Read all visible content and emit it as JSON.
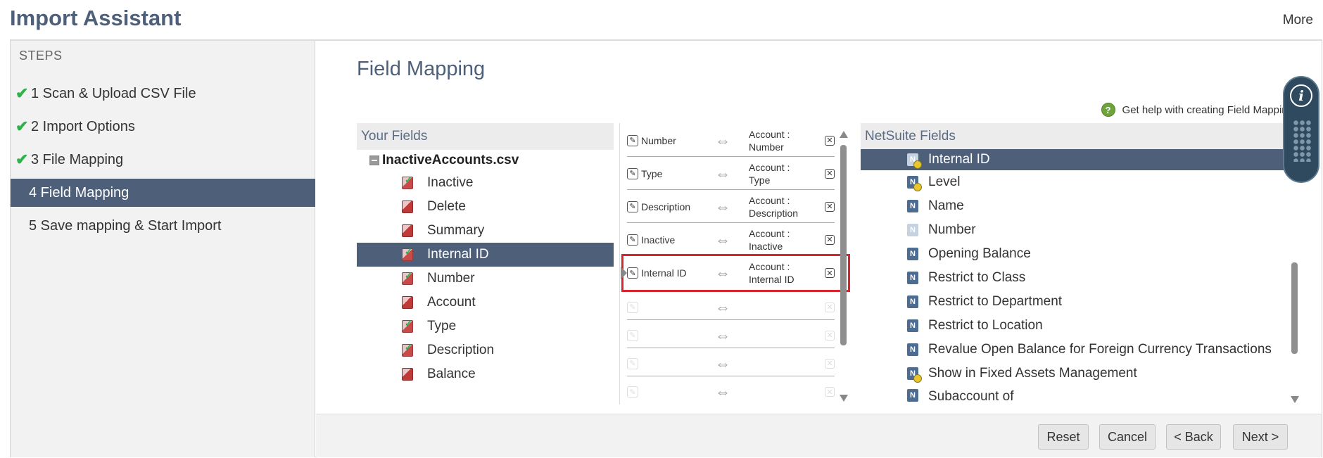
{
  "header": {
    "title": "Import Assistant",
    "more": "More"
  },
  "steps": {
    "heading": "STEPS",
    "items": [
      {
        "label": "1 Scan & Upload CSV File",
        "done": true
      },
      {
        "label": "2 Import Options",
        "done": true
      },
      {
        "label": "3 File Mapping",
        "done": true
      },
      {
        "label": "4 Field Mapping",
        "active": true
      },
      {
        "label": "5 Save mapping & Start Import"
      }
    ]
  },
  "main": {
    "title": "Field Mapping",
    "help_text": "Get help with creating Field Mapping"
  },
  "your_fields": {
    "heading": "Your Fields",
    "file": "InactiveAccounts.csv",
    "items": [
      {
        "label": "Inactive",
        "icon": "mapped-field-icon"
      },
      {
        "label": "Delete",
        "icon": "field-icon"
      },
      {
        "label": "Summary",
        "icon": "field-icon"
      },
      {
        "label": "Internal ID",
        "icon": "mapped-field-icon",
        "selected": true
      },
      {
        "label": "Number",
        "icon": "mapped-field-icon"
      },
      {
        "label": "Account",
        "icon": "field-icon"
      },
      {
        "label": "Type",
        "icon": "mapped-field-icon"
      },
      {
        "label": "Description",
        "icon": "mapped-field-icon"
      },
      {
        "label": "Balance",
        "icon": "field-icon"
      }
    ]
  },
  "mappings": [
    {
      "source": "Number",
      "target_line1": "Account :",
      "target_line2": "Number"
    },
    {
      "source": "Type",
      "target_line1": "Account :",
      "target_line2": "Type"
    },
    {
      "source": "Description",
      "target_line1": "Account :",
      "target_line2": "Description"
    },
    {
      "source": "Inactive",
      "target_line1": "Account :",
      "target_line2": "Inactive"
    },
    {
      "source": "Internal ID",
      "target_line1": "Account :",
      "target_line2": "Internal ID",
      "highlighted": true
    }
  ],
  "netsuite_fields": {
    "heading": "NetSuite Fields",
    "items": [
      {
        "label": "Internal ID",
        "selected": true
      },
      {
        "label": "Level"
      },
      {
        "label": "Name"
      },
      {
        "label": "Number"
      },
      {
        "label": "Opening Balance"
      },
      {
        "label": "Restrict to Class"
      },
      {
        "label": "Restrict to Department"
      },
      {
        "label": "Restrict to Location"
      },
      {
        "label": "Revalue Open Balance for Foreign Currency Transactions"
      },
      {
        "label": "Show in Fixed Assets Management"
      },
      {
        "label": "Subaccount of"
      }
    ]
  },
  "footer": {
    "reset": "Reset",
    "cancel": "Cancel",
    "back": "< Back",
    "next": "Next >"
  }
}
